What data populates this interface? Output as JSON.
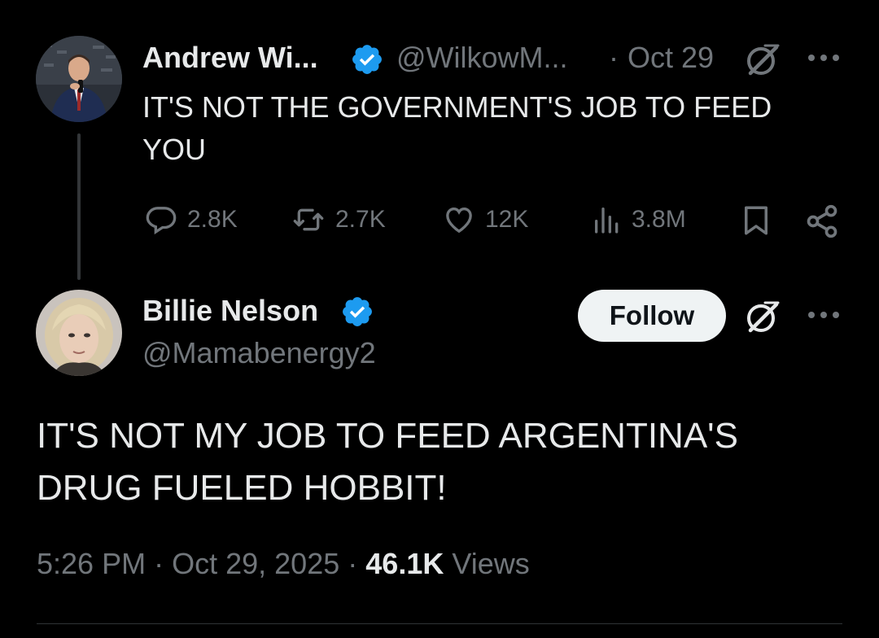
{
  "parent_tweet": {
    "author_name": "Andrew Wi...",
    "handle": "@WilkowM...",
    "separator": "·",
    "date": "Oct 29",
    "text": "IT'S NOT THE GOVERNMENT'S JOB TO FEED YOU",
    "verified": true,
    "stats": {
      "replies": "2.8K",
      "reposts": "2.7K",
      "likes": "12K",
      "views": "3.8M"
    }
  },
  "reply_tweet": {
    "author_name": "Billie Nelson",
    "handle": "@Mamabenergy2",
    "verified": true,
    "follow_label": "Follow",
    "text": "IT'S NOT MY JOB TO FEED ARGENTINA'S DRUG FUELED HOBBIT!",
    "time": "5:26 PM",
    "date": "Oct 29, 2025",
    "separator": "·",
    "views_count": "46.1K",
    "views_label": "Views"
  },
  "colors": {
    "background": "#000000",
    "text_primary": "#e7e9ea",
    "text_secondary": "#71767b",
    "verified_blue": "#1d9bf0",
    "follow_bg": "#eff3f4"
  },
  "icons": {
    "verified": "verified-badge-icon",
    "grok": "grok-icon",
    "more": "more-dots-icon",
    "reply": "reply-icon",
    "repost": "repost-icon",
    "like": "heart-icon",
    "views": "views-chart-icon",
    "bookmark": "bookmark-icon",
    "share": "share-icon"
  }
}
